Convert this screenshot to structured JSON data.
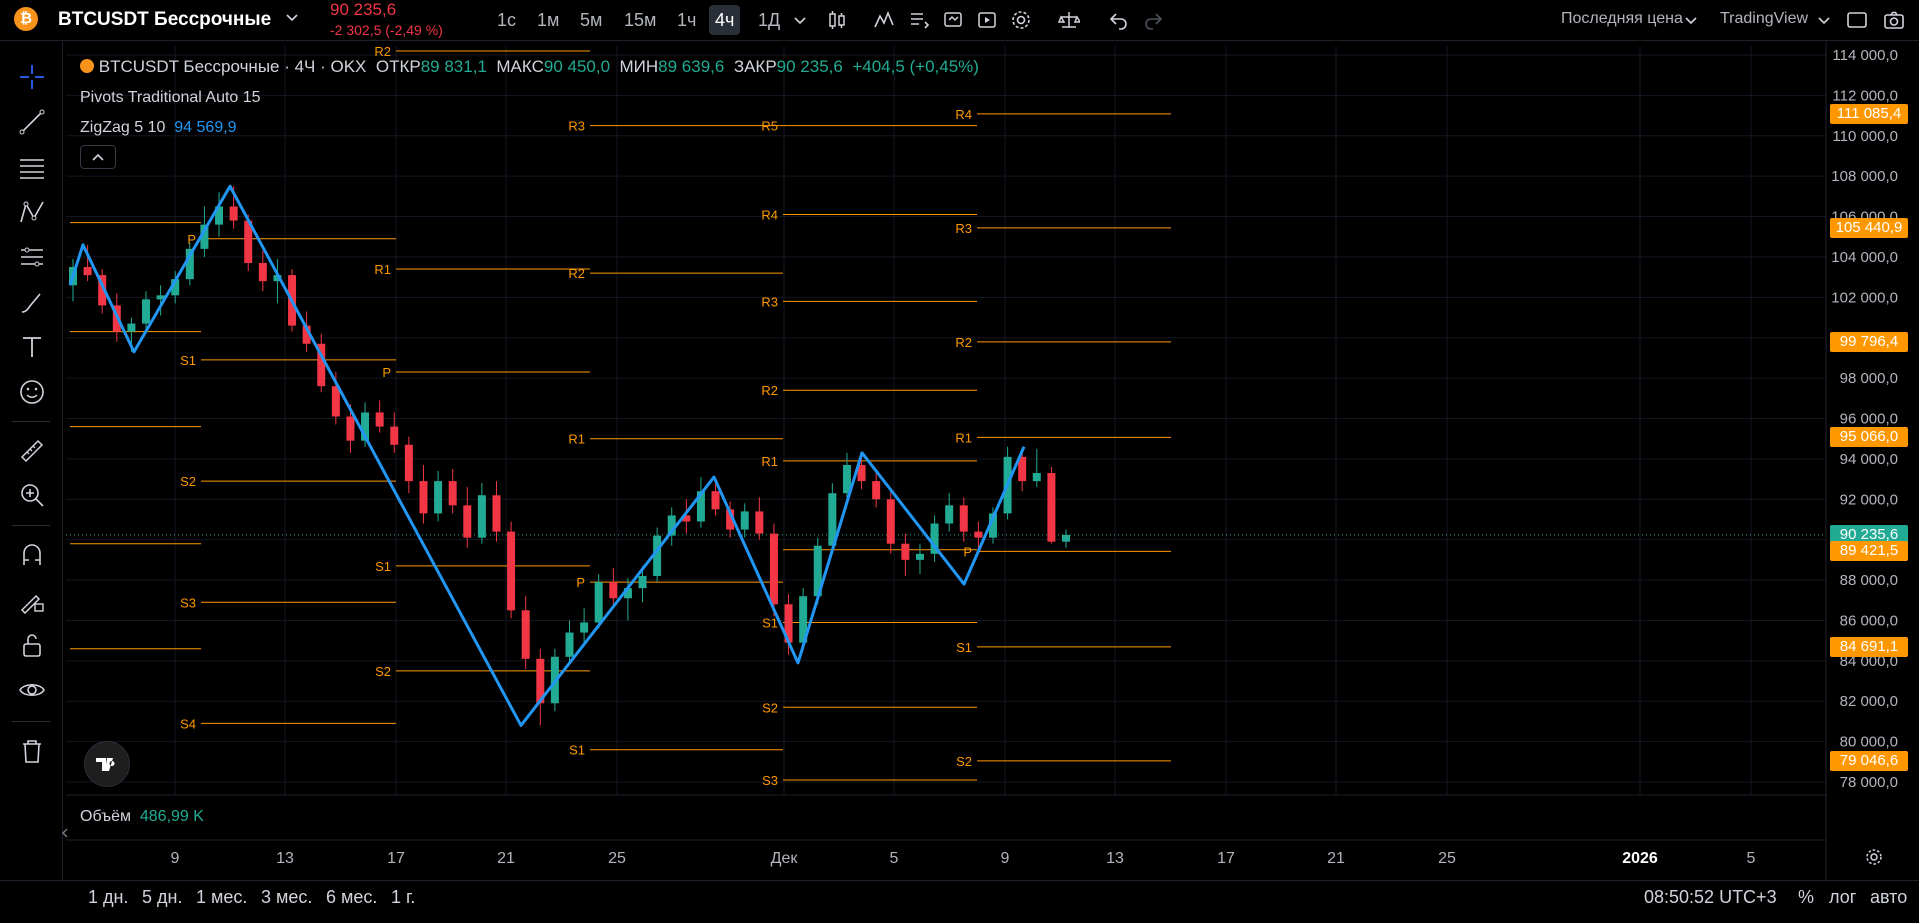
{
  "header": {
    "symbol_icon": "₿",
    "symbol": "BTCUSDT Бессрочные",
    "last_price": "90 235,6",
    "change": "-2 302,5 (-2,49 %)",
    "timeframes": [
      "1с",
      "1м",
      "5м",
      "15м",
      "1ч",
      "4ч",
      "1Д"
    ],
    "active_timeframe": "4ч",
    "price_type": "Последняя цена",
    "chart_provider": "TradingView"
  },
  "legend": {
    "title": "BTCUSDT Бессрочные · 4Ч · OKX",
    "open_label": "ОТКР",
    "open": "89 831,1",
    "high_label": "МАКС",
    "high": "90 450,0",
    "low_label": "МИН",
    "low": "89 639,6",
    "close_label": "ЗАКР",
    "close": "90 235,6",
    "change": "+404,5 (+0,45%)"
  },
  "indicators": {
    "pivots": "Pivots Traditional Auto 15",
    "zigzag": "ZigZag 5 10",
    "zigzag_value": "94 569,9"
  },
  "volume": {
    "label": "Объём",
    "value": "486,99 K"
  },
  "bottom": {
    "ranges": [
      "1 дн.",
      "5 дн.",
      "1 мес.",
      "3 мес.",
      "6 мес.",
      "1 г."
    ],
    "clock": "08:50:52 UTC+3",
    "percent": "%",
    "log": "лог",
    "auto": "авто"
  },
  "colors": {
    "up": "#22ab94",
    "down": "#f23645",
    "pivot": "#ff9800",
    "zigzag": "#2196f3",
    "brand": "#f7931a"
  },
  "chart_data": {
    "type": "candlestick",
    "y_ticks": [
      "114 000,0",
      "112 000,0",
      "110 000,0",
      "108 000,0",
      "106 000,0",
      "104 000,0",
      "102 000,0",
      "100 000,0",
      "98 000,0",
      "96 000,0",
      "94 000,0",
      "92 000,0",
      "90 000,0",
      "88 000,0",
      "86 000,0",
      "84 000,0",
      "82 000,0",
      "80 000,0",
      "78 000,0"
    ],
    "y_range": [
      77000,
      115000
    ],
    "x_ticks": [
      "9",
      "13",
      "17",
      "21",
      "25",
      "Дек",
      "5",
      "9",
      "13",
      "17",
      "21",
      "25",
      "2026",
      "5"
    ],
    "price_badges": [
      {
        "label": "111 085,4",
        "value": 111085.4
      },
      {
        "label": "105 440,9",
        "value": 105440.9
      },
      {
        "label": "99 796,4",
        "value": 99796.4
      },
      {
        "label": "95 066,0",
        "value": 95066.0
      },
      {
        "label": "90 235,6",
        "value": 90235.6,
        "current": true
      },
      {
        "label": "89 421,5",
        "value": 89421.5
      },
      {
        "label": "84 691,1",
        "value": 84691.1
      },
      {
        "label": "79 046,6",
        "value": 79046.6
      }
    ],
    "pivot_periods": [
      {
        "levels": [
          {
            "n": "P",
            "v": 104900
          },
          {
            "n": "S1",
            "v": 98900
          },
          {
            "n": "S2",
            "v": 92900
          },
          {
            "n": "S3",
            "v": 86900
          },
          {
            "n": "S4",
            "v": 80900
          }
        ]
      },
      {
        "levels": [
          {
            "n": "R2",
            "v": 114200
          },
          {
            "n": "R1",
            "v": 103400
          },
          {
            "n": "P",
            "v": 98300
          },
          {
            "n": "S1",
            "v": 88700
          },
          {
            "n": "S2",
            "v": 83500
          }
        ]
      },
      {
        "levels": [
          {
            "n": "R3",
            "v": 110500
          },
          {
            "n": "R2",
            "v": 103200
          },
          {
            "n": "R1",
            "v": 95000
          },
          {
            "n": "P",
            "v": 87900
          },
          {
            "n": "S1",
            "v": 79600
          }
        ]
      },
      {
        "levels": [
          {
            "n": "R5",
            "v": 110500
          },
          {
            "n": "R4",
            "v": 106100
          },
          {
            "n": "R3",
            "v": 101800
          },
          {
            "n": "R2",
            "v": 97400
          },
          {
            "n": "R1",
            "v": 93900
          },
          {
            "n": "P",
            "v": 89500
          },
          {
            "n": "S1",
            "v": 85900
          },
          {
            "n": "S2",
            "v": 81700
          },
          {
            "n": "S3",
            "v": 78100
          }
        ]
      },
      {
        "levels": [
          {
            "n": "R4",
            "v": 111085.4
          },
          {
            "n": "R3",
            "v": 105440.9
          },
          {
            "n": "R2",
            "v": 99796.4
          },
          {
            "n": "R1",
            "v": 95066.0
          },
          {
            "n": "P",
            "v": 89421.5
          },
          {
            "n": "S1",
            "v": 84691.1
          },
          {
            "n": "S2",
            "v": 79046.6
          }
        ]
      }
    ],
    "zigzag": [
      102600,
      104600,
      99300,
      107500,
      80800,
      93100,
      83900,
      94300,
      87800,
      94600
    ],
    "candles": [
      [
        102600,
        103900,
        101800,
        103500
      ],
      [
        103500,
        104600,
        102800,
        103100
      ],
      [
        103100,
        103400,
        101200,
        101600
      ],
      [
        101600,
        102200,
        99800,
        100300
      ],
      [
        100300,
        101000,
        99300,
        100700
      ],
      [
        100700,
        102300,
        100300,
        101900
      ],
      [
        101900,
        102600,
        101100,
        102100
      ],
      [
        102100,
        103300,
        101700,
        102900
      ],
      [
        102900,
        104700,
        102600,
        104400
      ],
      [
        104400,
        106500,
        104000,
        105600
      ],
      [
        105600,
        107200,
        105000,
        106500
      ],
      [
        106500,
        107500,
        105400,
        105800
      ],
      [
        105800,
        106100,
        103300,
        103700
      ],
      [
        103700,
        104300,
        102300,
        102800
      ],
      [
        102800,
        103900,
        101700,
        103100
      ],
      [
        103100,
        103400,
        100300,
        100600
      ],
      [
        100600,
        101300,
        99300,
        99700
      ],
      [
        99700,
        100200,
        97300,
        97600
      ],
      [
        97600,
        98300,
        95700,
        96100
      ],
      [
        96100,
        96700,
        94300,
        94900
      ],
      [
        94900,
        96800,
        94600,
        96300
      ],
      [
        96300,
        96900,
        95300,
        95600
      ],
      [
        95600,
        96300,
        94300,
        94700
      ],
      [
        94700,
        95100,
        92300,
        92900
      ],
      [
        92900,
        93700,
        90800,
        91300
      ],
      [
        91300,
        93400,
        90900,
        92900
      ],
      [
        92900,
        93500,
        91300,
        91700
      ],
      [
        91700,
        92600,
        89600,
        90100
      ],
      [
        90100,
        92800,
        89800,
        92200
      ],
      [
        92200,
        92900,
        89900,
        90400
      ],
      [
        90400,
        90900,
        86100,
        86500
      ],
      [
        86500,
        87200,
        83600,
        84100
      ],
      [
        84100,
        84600,
        80800,
        81900
      ],
      [
        81900,
        84600,
        81500,
        84200
      ],
      [
        84200,
        86000,
        83800,
        85400
      ],
      [
        85400,
        86600,
        84900,
        85900
      ],
      [
        85900,
        88300,
        85600,
        87900
      ],
      [
        87900,
        88600,
        86700,
        87100
      ],
      [
        87100,
        88100,
        86000,
        87600
      ],
      [
        87600,
        88700,
        86900,
        88200
      ],
      [
        88200,
        90600,
        87900,
        90200
      ],
      [
        90200,
        91600,
        89700,
        91200
      ],
      [
        91200,
        92000,
        90300,
        90900
      ],
      [
        90900,
        93100,
        90600,
        92400
      ],
      [
        92400,
        92900,
        91200,
        91500
      ],
      [
        91500,
        91900,
        90100,
        90500
      ],
      [
        90500,
        91800,
        90100,
        91400
      ],
      [
        91400,
        92100,
        90000,
        90300
      ],
      [
        90300,
        90800,
        86200,
        86800
      ],
      [
        86800,
        87300,
        84300,
        84900
      ],
      [
        84900,
        87600,
        84500,
        87200
      ],
      [
        87200,
        90100,
        86800,
        89700
      ],
      [
        89700,
        92800,
        89300,
        92300
      ],
      [
        92300,
        94300,
        91800,
        93700
      ],
      [
        93700,
        94100,
        92500,
        92900
      ],
      [
        92900,
        93500,
        91600,
        92000
      ],
      [
        92000,
        92400,
        89300,
        89800
      ],
      [
        89800,
        90300,
        88200,
        89000
      ],
      [
        89000,
        89800,
        88300,
        89300
      ],
      [
        89300,
        91200,
        88900,
        90800
      ],
      [
        90800,
        92300,
        90400,
        91700
      ],
      [
        91700,
        92100,
        89900,
        90400
      ],
      [
        90400,
        90900,
        89600,
        90100
      ],
      [
        90100,
        91600,
        89800,
        91300
      ],
      [
        91300,
        94600,
        91000,
        94100
      ],
      [
        94100,
        94300,
        92400,
        92900
      ],
      [
        92900,
        94500,
        92600,
        93300
      ],
      [
        93300,
        93600,
        89800,
        89900
      ],
      [
        89900,
        90500,
        89600,
        90236
      ]
    ]
  }
}
